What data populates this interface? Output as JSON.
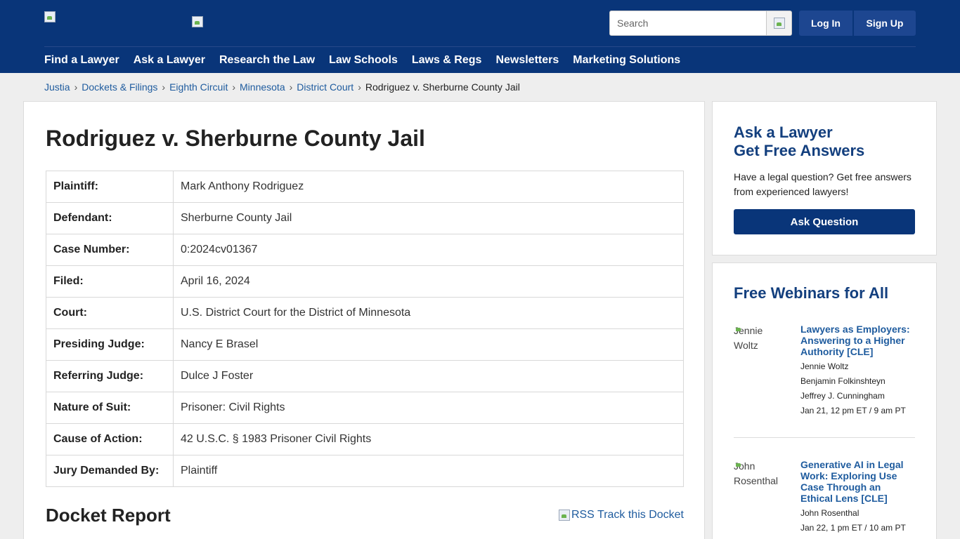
{
  "header": {
    "logo_alt": "",
    "search_placeholder": "Search",
    "login_label": "Log In",
    "signup_label": "Sign Up",
    "nav": [
      "Find a Lawyer",
      "Ask a Lawyer",
      "Research the Law",
      "Law Schools",
      "Laws & Regs",
      "Newsletters",
      "Marketing Solutions"
    ]
  },
  "breadcrumb": {
    "items": [
      "Justia",
      "Dockets & Filings",
      "Eighth Circuit",
      "Minnesota",
      "District Court"
    ],
    "current": "Rodriguez v. Sherburne County Jail",
    "separator": "›"
  },
  "case": {
    "title": "Rodriguez v. Sherburne County Jail",
    "rows": [
      {
        "label": "Plaintiff:",
        "value": "Mark Anthony Rodriguez"
      },
      {
        "label": "Defendant:",
        "value": "Sherburne County Jail"
      },
      {
        "label": "Case Number:",
        "value": "0:2024cv01367"
      },
      {
        "label": "Filed:",
        "value": "April 16, 2024"
      },
      {
        "label": "Court:",
        "value": "U.S. District Court for the District of Minnesota"
      },
      {
        "label": "Presiding Judge:",
        "value": "Nancy E Brasel"
      },
      {
        "label": "Referring Judge:",
        "value": "Dulce J Foster"
      },
      {
        "label": "Nature of Suit:",
        "value": "Prisoner: Civil Rights"
      },
      {
        "label": "Cause of Action:",
        "value": "42 U.S.C. § 1983 Prisoner Civil Rights"
      },
      {
        "label": "Jury Demanded By:",
        "value": "Plaintiff"
      }
    ],
    "docket_title": "Docket Report",
    "rss_alt": "RSS",
    "rss_label": "RSS Track this Docket"
  },
  "ask_card": {
    "title_line1": "Ask a Lawyer",
    "title_line2": "Get Free Answers",
    "description": "Have a legal question? Get free answers from experienced lawyers!",
    "button_label": "Ask Question"
  },
  "webinars": {
    "title": "Free Webinars for All",
    "items": [
      {
        "photo_alt_1": "Jennie",
        "photo_alt_2": "Woltz",
        "title": "Lawyers as Employers: Answering to a Higher Authority [CLE]",
        "speakers": [
          "Jennie Woltz",
          "Benjamin Folkinshteyn",
          "Jeffrey J. Cunningham"
        ],
        "date": "Jan 21, 12 pm ET / 9 am PT"
      },
      {
        "photo_alt_1": "John",
        "photo_alt_2": "Rosenthal",
        "title": "Generative AI in Legal Work: Exploring Use Case Through an Ethical Lens [CLE]",
        "speakers": [
          "John Rosenthal"
        ],
        "date": "Jan 22, 1 pm ET / 10 am PT"
      }
    ]
  }
}
